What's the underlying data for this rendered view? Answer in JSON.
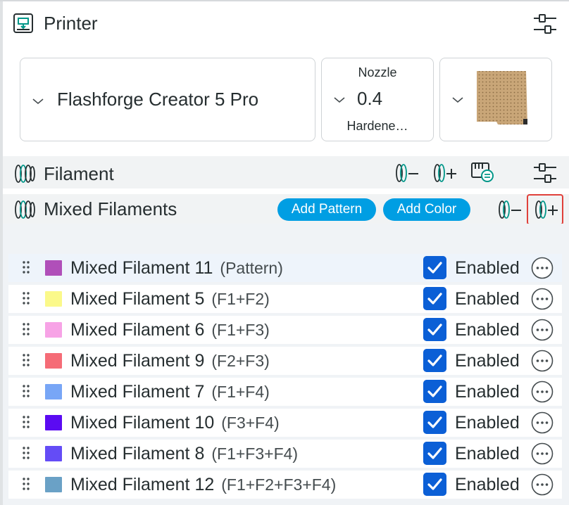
{
  "printer_section": {
    "title": "Printer",
    "printer_name": "Flashforge Creator 5 Pro",
    "nozzle_label": "Nozzle",
    "nozzle_size": "0.4",
    "nozzle_type": "Hardene…"
  },
  "filament_section": {
    "title": "Filament"
  },
  "mixed_section": {
    "title": "Mixed Filaments",
    "add_pattern_label": "Add Pattern",
    "add_color_label": "Add Color"
  },
  "mixed_filaments": [
    {
      "name": "Mixed Filament 11",
      "composition": "(Pattern)",
      "status": "Enabled",
      "color": "#b04fb9"
    },
    {
      "name": "Mixed Filament 5",
      "composition": "(F1+F2)",
      "status": "Enabled",
      "color": "#fbf98a"
    },
    {
      "name": "Mixed Filament 6",
      "composition": "(F1+F3)",
      "status": "Enabled",
      "color": "#f7a3e6"
    },
    {
      "name": "Mixed Filament 9",
      "composition": "(F2+F3)",
      "status": "Enabled",
      "color": "#f56c77"
    },
    {
      "name": "Mixed Filament 7",
      "composition": "(F1+F4)",
      "status": "Enabled",
      "color": "#78a6f6"
    },
    {
      "name": "Mixed Filament 10",
      "composition": "(F3+F4)",
      "status": "Enabled",
      "color": "#5b0bf2"
    },
    {
      "name": "Mixed Filament 8",
      "composition": "(F1+F3+F4)",
      "status": "Enabled",
      "color": "#644cf6"
    },
    {
      "name": "Mixed Filament 12",
      "composition": "(F1+F2+F3+F4)",
      "status": "Enabled",
      "color": "#6aa1c6"
    }
  ],
  "colors": {
    "accent": "#009ee3",
    "checkbox": "#0b5fd6",
    "highlight": "#e0403a",
    "brand_green": "#009688"
  }
}
